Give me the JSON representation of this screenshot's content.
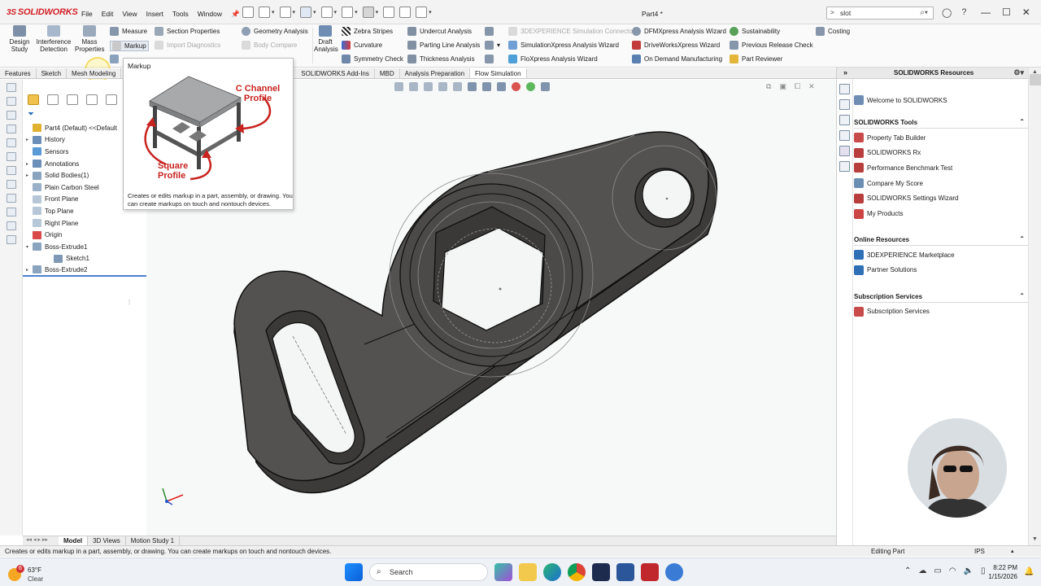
{
  "app": {
    "logo_prefix": "3S",
    "logo_text": "SOLIDWORKS",
    "document_title": "Part4 *"
  },
  "menu": [
    "File",
    "Edit",
    "View",
    "Insert",
    "Tools",
    "Window"
  ],
  "search": {
    "prefix": ">",
    "value": "slot"
  },
  "ribbon": {
    "design_study": "Design\nStudy",
    "interference_detection": "Interference\nDetection",
    "mass_properties": "Mass\nProperties",
    "measure": "Measure",
    "markup": "Markup",
    "section_properties": "Section Properties",
    "import_diagnostics": "Import Diagnostics",
    "geometry_analysis": "Geometry Analysis",
    "body_compare": "Body Compare",
    "draft_analysis": "Draft\nAnalysis",
    "zebra_stripes": "Zebra Stripes",
    "curvature": "Curvature",
    "symmetry_check": "Symmetry Check",
    "undercut_analysis": "Undercut Analysis",
    "parting_line_analysis": "Parting Line Analysis",
    "thickness_analysis": "Thickness Analysis",
    "experience_sim": "3DEXPERIENCE Simulation Connector",
    "simxpress": "SimulationXpress Analysis Wizard",
    "floxpress": "FloXpress Analysis Wizard",
    "dfmxpress": "DFMXpress Analysis Wizard",
    "driveworks": "DriveWorksXpress Wizard",
    "on_demand": "On Demand Manufacturing",
    "sustainability": "Sustainability",
    "previous_release": "Previous Release Check",
    "part_reviewer": "Part Reviewer",
    "costing": "Costing"
  },
  "tabs": [
    "Features",
    "Sketch",
    "Mesh Modeling",
    "SOLIDWORKS Add-Ins",
    "MBD",
    "Analysis Preparation",
    "Flow Simulation"
  ],
  "tooltip": {
    "title": "Markup",
    "label_c_channel": "C Channel\nProfile",
    "label_square": "Square\nProfile",
    "description": "Creates or edits markup in a part, assembly, or drawing. You can create markups on touch and nontouch devices."
  },
  "feature_tree": [
    {
      "label": "Part4 (Default) <<Default",
      "arrow": "",
      "icon": "#e0b030"
    },
    {
      "label": "History",
      "arrow": "▸",
      "icon": "#6b8fb8"
    },
    {
      "label": "Sensors",
      "arrow": "",
      "icon": "#5a9ad6"
    },
    {
      "label": "Annotations",
      "arrow": "▸",
      "icon": "#6b8fb8"
    },
    {
      "label": "Solid Bodies(1)",
      "arrow": "▸",
      "icon": "#8aa4c0"
    },
    {
      "label": "Plain Carbon Steel",
      "arrow": "",
      "icon": "#9ab0c8"
    },
    {
      "label": "Front Plane",
      "arrow": "",
      "icon": "#b7c7d8"
    },
    {
      "label": "Top Plane",
      "arrow": "",
      "icon": "#b7c7d8"
    },
    {
      "label": "Right Plane",
      "arrow": "",
      "icon": "#b7c7d8"
    },
    {
      "label": "Origin",
      "arrow": "",
      "icon": "#d94b4b"
    },
    {
      "label": "Boss-Extrude1",
      "arrow": "▾",
      "icon": "#8aa4c0"
    },
    {
      "label": "Sketch1",
      "arrow": "",
      "icon": "#7f98b5",
      "indent": true
    },
    {
      "label": "Boss-Extrude2",
      "arrow": "▸",
      "icon": "#8aa4c0"
    }
  ],
  "bottom_tabs": [
    "Model",
    "3D Views",
    "Motion Study 1"
  ],
  "status": {
    "message": "Creates or edits markup in a part, assembly, or drawing. You can create markups on touch and nontouch devices.",
    "mode": "Editing Part",
    "units": "IPS"
  },
  "taskpane": {
    "title": "SOLIDWORKS Resources",
    "welcome": "Welcome to SOLIDWORKS",
    "sections": [
      {
        "title": "SOLIDWORKS Tools",
        "items": [
          "Property Tab Builder",
          "SOLIDWORKS Rx",
          "Performance Benchmark Test",
          "Compare My Score",
          "SOLIDWORKS Settings Wizard",
          "My Products"
        ]
      },
      {
        "title": "Online Resources",
        "items": [
          "3DEXPERIENCE Marketplace",
          "Partner Solutions"
        ]
      },
      {
        "title": "Subscription Services",
        "items": [
          "Subscription Services"
        ]
      }
    ]
  },
  "taskbar": {
    "weather_badge": "6",
    "temperature": "63°F",
    "condition": "Clear",
    "search_placeholder": "Search",
    "time": "8:22 PM",
    "date": "1/15/2026"
  },
  "colors": {
    "model_face": "#545251",
    "model_edge": "#0f0f0f",
    "accent": "#c8231f",
    "selection": "#4b7fd1"
  }
}
